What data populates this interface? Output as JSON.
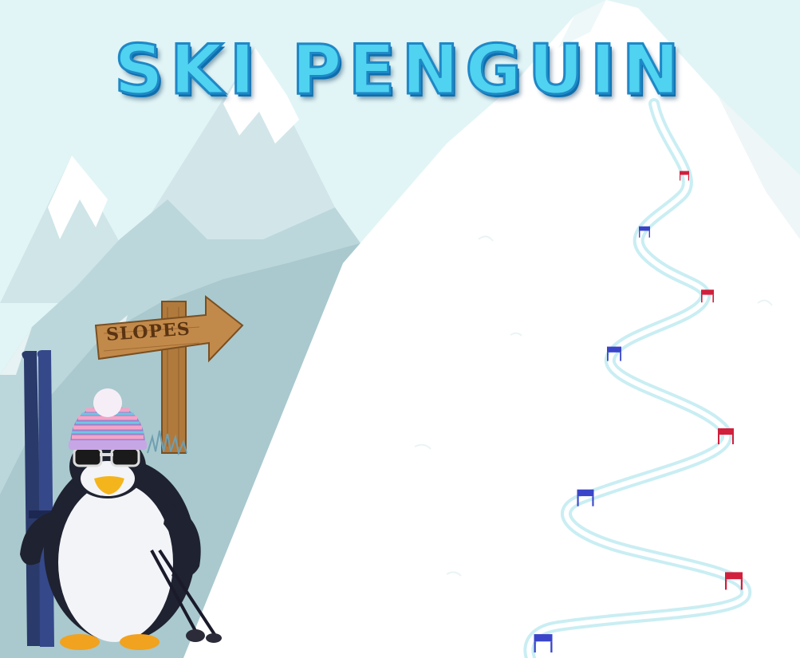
{
  "game": {
    "title": "SKI PENGUIN",
    "sign_label": "SLOPES"
  },
  "colors": {
    "sky": "#e2f5f6",
    "snow": "#ffffff",
    "title_fill": "#4fd3f0",
    "title_outline": "#1e88c7",
    "gate_red": "#d11f3c",
    "gate_blue": "#3a45c9",
    "track": "#c9eef3",
    "wood": "#b07a3d"
  },
  "gates": [
    {
      "color": "red"
    },
    {
      "color": "blue"
    },
    {
      "color": "red"
    },
    {
      "color": "blue"
    },
    {
      "color": "red"
    },
    {
      "color": "blue"
    },
    {
      "color": "red"
    },
    {
      "color": "blue"
    }
  ]
}
